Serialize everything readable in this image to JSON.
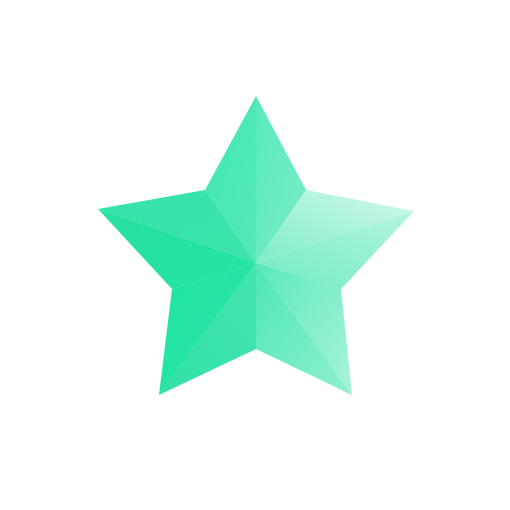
{
  "icon": {
    "name": "star-icon",
    "colors": {
      "base": "#2fe1a7",
      "deep": "#1ee3a3",
      "mid": "#4ae6b8",
      "light": "#8df0d0",
      "highlight": "#c8f8e8",
      "background": "#ffffff"
    }
  }
}
